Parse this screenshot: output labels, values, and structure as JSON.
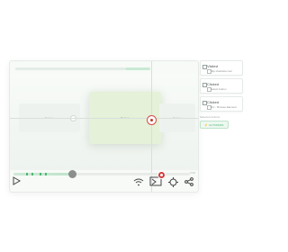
{
  "colors": {
    "accent": "#4cb875",
    "record": "#d43b3b",
    "canvas_highlight": "#e5f1d8"
  },
  "canvas": {
    "cards": [
      {
        "label": "Button"
      },
      {
        "label": "Button"
      },
      {
        "label": "Button"
      }
    ]
  },
  "player": {
    "progress": 0.33,
    "markers": [
      0.07,
      0.1,
      0.15,
      0.18
    ],
    "timestamp": "0:00"
  },
  "toolbar": {
    "icons": [
      "play-icon",
      "signal-icon",
      "screen-record-icon",
      "target-icon",
      "share-icon"
    ],
    "record_badge": ""
  },
  "steps": [
    {
      "title": "Visited",
      "detail": "http://website.com",
      "icon": "link-icon"
    },
    {
      "title": "Clicked",
      "detail": "Select button",
      "icon": "cursor-icon"
    },
    {
      "title": "Clicked",
      "detail": "Div - Browse Element",
      "icon": "image-icon"
    }
  ],
  "sidebar": {
    "section_label": "Selected Actions",
    "automate_label": "AUTOMATE"
  }
}
